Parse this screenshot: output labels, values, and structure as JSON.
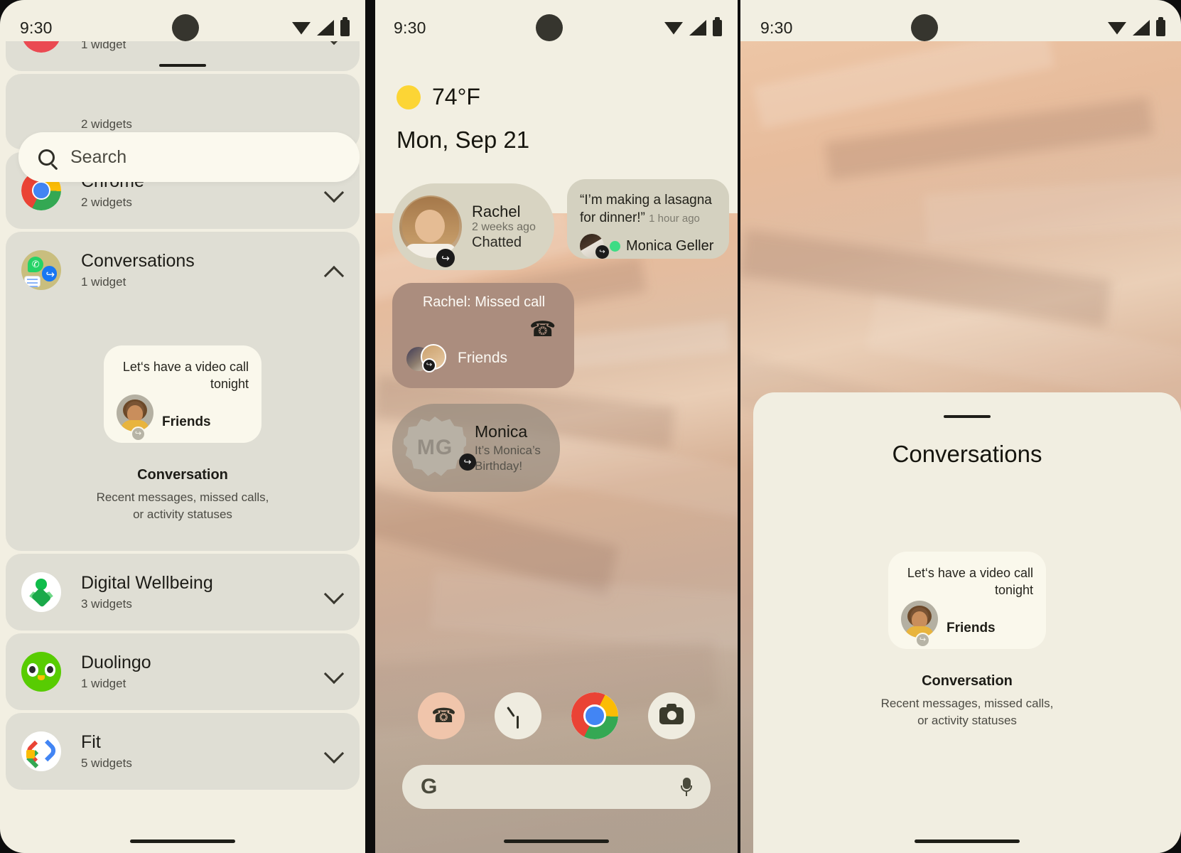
{
  "status_bar": {
    "time": "9:30",
    "icons": [
      "wifi-icon",
      "signal-icon",
      "battery-icon"
    ]
  },
  "panel1": {
    "name": "widget-picker",
    "search": {
      "placeholder": "Search"
    },
    "clipped_top_item": {
      "subtitle": "1 widget"
    },
    "hidden_behind_search": {
      "subtitle": "2 widgets"
    },
    "groups": [
      {
        "title": "Chrome",
        "subtitle": "2 widgets",
        "icon": "chrome-icon",
        "expanded": false,
        "chevron": "chevron-down-icon"
      },
      {
        "title": "Conversations",
        "subtitle": "1 widget",
        "icon": "conversations-icon",
        "expanded": true,
        "chevron": "chevron-up-icon"
      },
      {
        "title": "Digital Wellbeing",
        "subtitle": "3 widgets",
        "icon": "digital-wellbeing-icon",
        "expanded": false,
        "chevron": "chevron-down-icon"
      },
      {
        "title": "Duolingo",
        "subtitle": "1 widget",
        "icon": "duolingo-icon",
        "expanded": false,
        "chevron": "chevron-down-icon"
      },
      {
        "title": "Fit",
        "subtitle": "5 widgets",
        "icon": "fit-icon",
        "expanded": false,
        "chevron": "chevron-down-icon"
      }
    ],
    "widget_preview": {
      "message": "Let‘s have a video call tonight",
      "contact": "Friends",
      "title": "Conversation",
      "description": "Recent messages, missed calls, or activity statuses"
    }
  },
  "panel2": {
    "name": "home-screen",
    "weather": {
      "icon": "sun-icon",
      "temperature": "74°F"
    },
    "date": "Mon, Sep 21",
    "bubbles": [
      {
        "name": "Rachel",
        "time": "2 weeks ago",
        "status": "Chatted",
        "badge": "messenger-icon",
        "avatar": "rachel-avatar"
      },
      {
        "quote": "“I’m making a lasagna for dinner!”",
        "time": "1 hour ago",
        "name": "Monica Geller",
        "badge": "messenger-icon",
        "dot": "online-dot"
      },
      {
        "title": "Rachel: Missed call",
        "icon": "missed-call-icon",
        "label": "Friends",
        "badge": "messenger-icon"
      },
      {
        "name": "Monica",
        "initials": "MG",
        "status": "It’s Monica’s Birthday!",
        "badge": "messenger-icon"
      }
    ],
    "dock": [
      {
        "label": "Phone",
        "icon": "phone-icon"
      },
      {
        "label": "Clock",
        "icon": "clock-icon"
      },
      {
        "label": "Chrome",
        "icon": "chrome-icon"
      },
      {
        "label": "Camera",
        "icon": "camera-icon"
      }
    ],
    "google_bar": {
      "logo": "google-g-icon",
      "mic": "microphone-icon"
    }
  },
  "panel3": {
    "name": "conversations-bottom-sheet",
    "title": "Conversations",
    "widget_preview": {
      "message": "Let‘s have a video call tonight",
      "contact": "Friends",
      "title": "Conversation",
      "description": "Recent messages, missed calls, or activity statuses"
    }
  },
  "colors": {
    "surface": "#f2efe2",
    "group_bg": "#dfded4",
    "card": "#faf8ec",
    "accent_brown": "#ab8d7e",
    "text_primary": "#1d1c17",
    "text_secondary": "#4c4b44"
  }
}
